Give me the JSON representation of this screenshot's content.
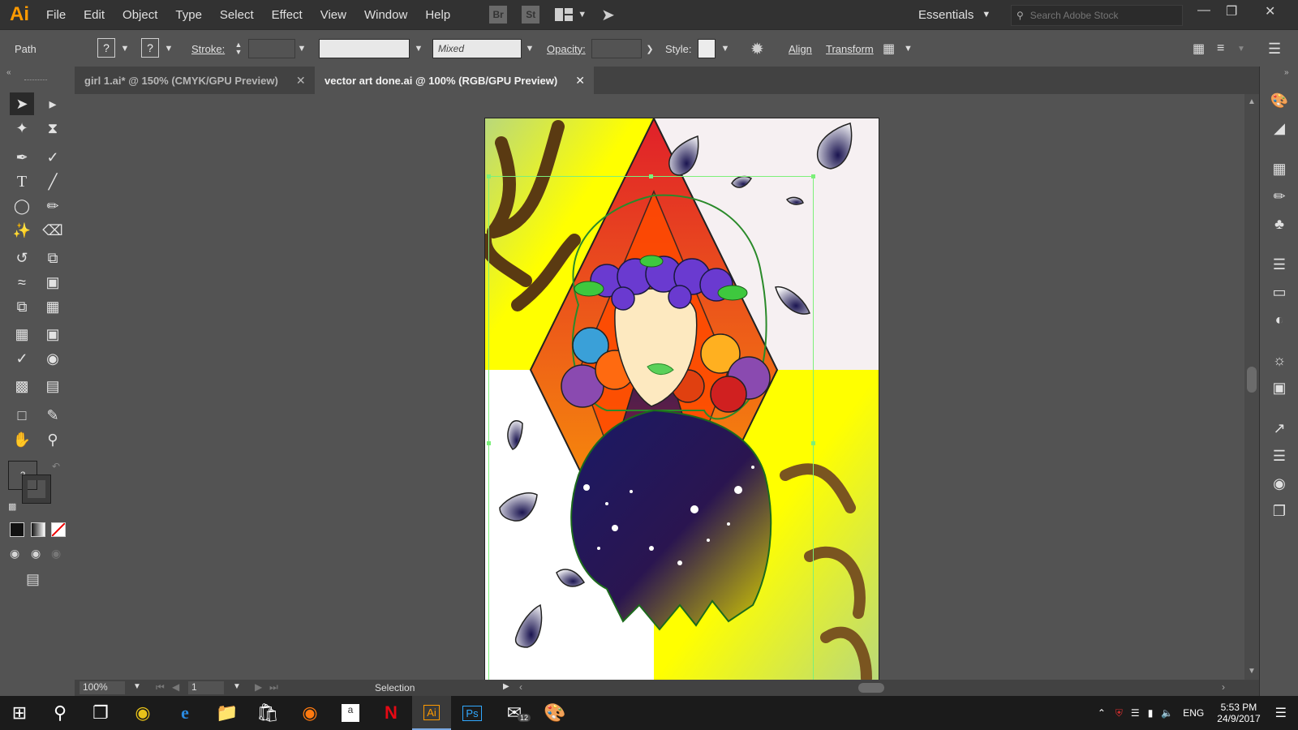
{
  "app": {
    "logo": "Ai"
  },
  "menu": [
    "File",
    "Edit",
    "Object",
    "Type",
    "Select",
    "Effect",
    "View",
    "Window",
    "Help"
  ],
  "menubar_buttons": {
    "bridge": "Br",
    "stock": "St"
  },
  "workspace": {
    "label": "Essentials"
  },
  "search": {
    "placeholder": "Search Adobe Stock"
  },
  "control_bar": {
    "selection_type": "Path",
    "fill_swatch": "?",
    "stroke_swatch": "?",
    "stroke_label": "Stroke:",
    "brush_value": "Mixed",
    "opacity_label": "Opacity:",
    "style_label": "Style:",
    "align_label": "Align",
    "transform_label": "Transform"
  },
  "tabs": [
    {
      "label": "girl 1.ai* @ 150% (CMYK/GPU Preview)",
      "active": false
    },
    {
      "label": "vector art done.ai @ 100% (RGB/GPU Preview)",
      "active": true
    }
  ],
  "status": {
    "zoom": "100%",
    "artboard": "1",
    "tool": "Selection"
  },
  "taskbar": {
    "mail_badge": "12",
    "lang": "ENG",
    "time": "5:53 PM",
    "date": "24/9/2017"
  },
  "colors": {
    "accent_orange": "#ff9a00",
    "ui_dark": "#323232",
    "ui_mid": "#535353",
    "selection_green": "#7cf07a"
  }
}
